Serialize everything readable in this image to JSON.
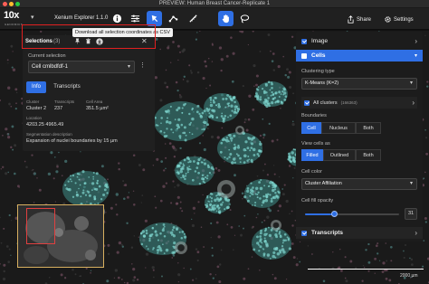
{
  "window": {
    "title": "PREVIEW: Human Breast Cancer-Replicate 1"
  },
  "toolbar": {
    "logo_mark": "10x",
    "logo_sub": "GENOMICS",
    "app_name": "Xenium Explorer 1.1.0",
    "icons": [
      "info-icon",
      "sliders-icon",
      "lasso-select-icon",
      "path-icon",
      "pan-icon",
      "lasso-icon"
    ],
    "share_label": "Share",
    "settings_label": "Settings",
    "accent": "#2f6fe4"
  },
  "tooltip": "Download all selection coordinates as CSV",
  "selections": {
    "title": "Selections",
    "count": "(3)",
    "current_label": "Current selection",
    "current_value": "Cell cmlbdfdf-1",
    "tabs": [
      "Info",
      "Transcripts"
    ],
    "active_tab": "Info",
    "fields": {
      "cluster_lbl": "Cluster",
      "cluster_val": "Cluster 2",
      "transcripts_lbl": "Transcripts",
      "transcripts_val": "237",
      "area_lbl": "Cell Area",
      "area_val": "351.5 µm²",
      "location_lbl": "Location",
      "location_val": "4203.25 4965.49",
      "seg_lbl": "Segmentation description",
      "seg_val": "Expansion of nuclei boundaries by 15 µm"
    }
  },
  "right_panel": {
    "image_label": "Image",
    "cells_label": "Cells",
    "clustering_type_label": "Clustering type",
    "clustering_value": "K-Means (K=2)",
    "all_clusters_label": "All clusters",
    "all_clusters_count": "(166363)",
    "boundaries_label": "Boundaries",
    "boundaries_options": [
      "Cell",
      "Nucleus",
      "Both"
    ],
    "boundaries_selected": "Cell",
    "view_cells_label": "View cells as",
    "view_options": [
      "Filled",
      "Outlined",
      "Both"
    ],
    "view_selected": "Filled",
    "cell_color_label": "Cell color",
    "cell_color_value": "Cluster Affiliation",
    "opacity_label": "Cell fill opacity",
    "opacity_value": "31",
    "opacity_fraction": 0.31,
    "transcripts_label": "Transcripts"
  },
  "scale": {
    "label": "2000 µm"
  }
}
